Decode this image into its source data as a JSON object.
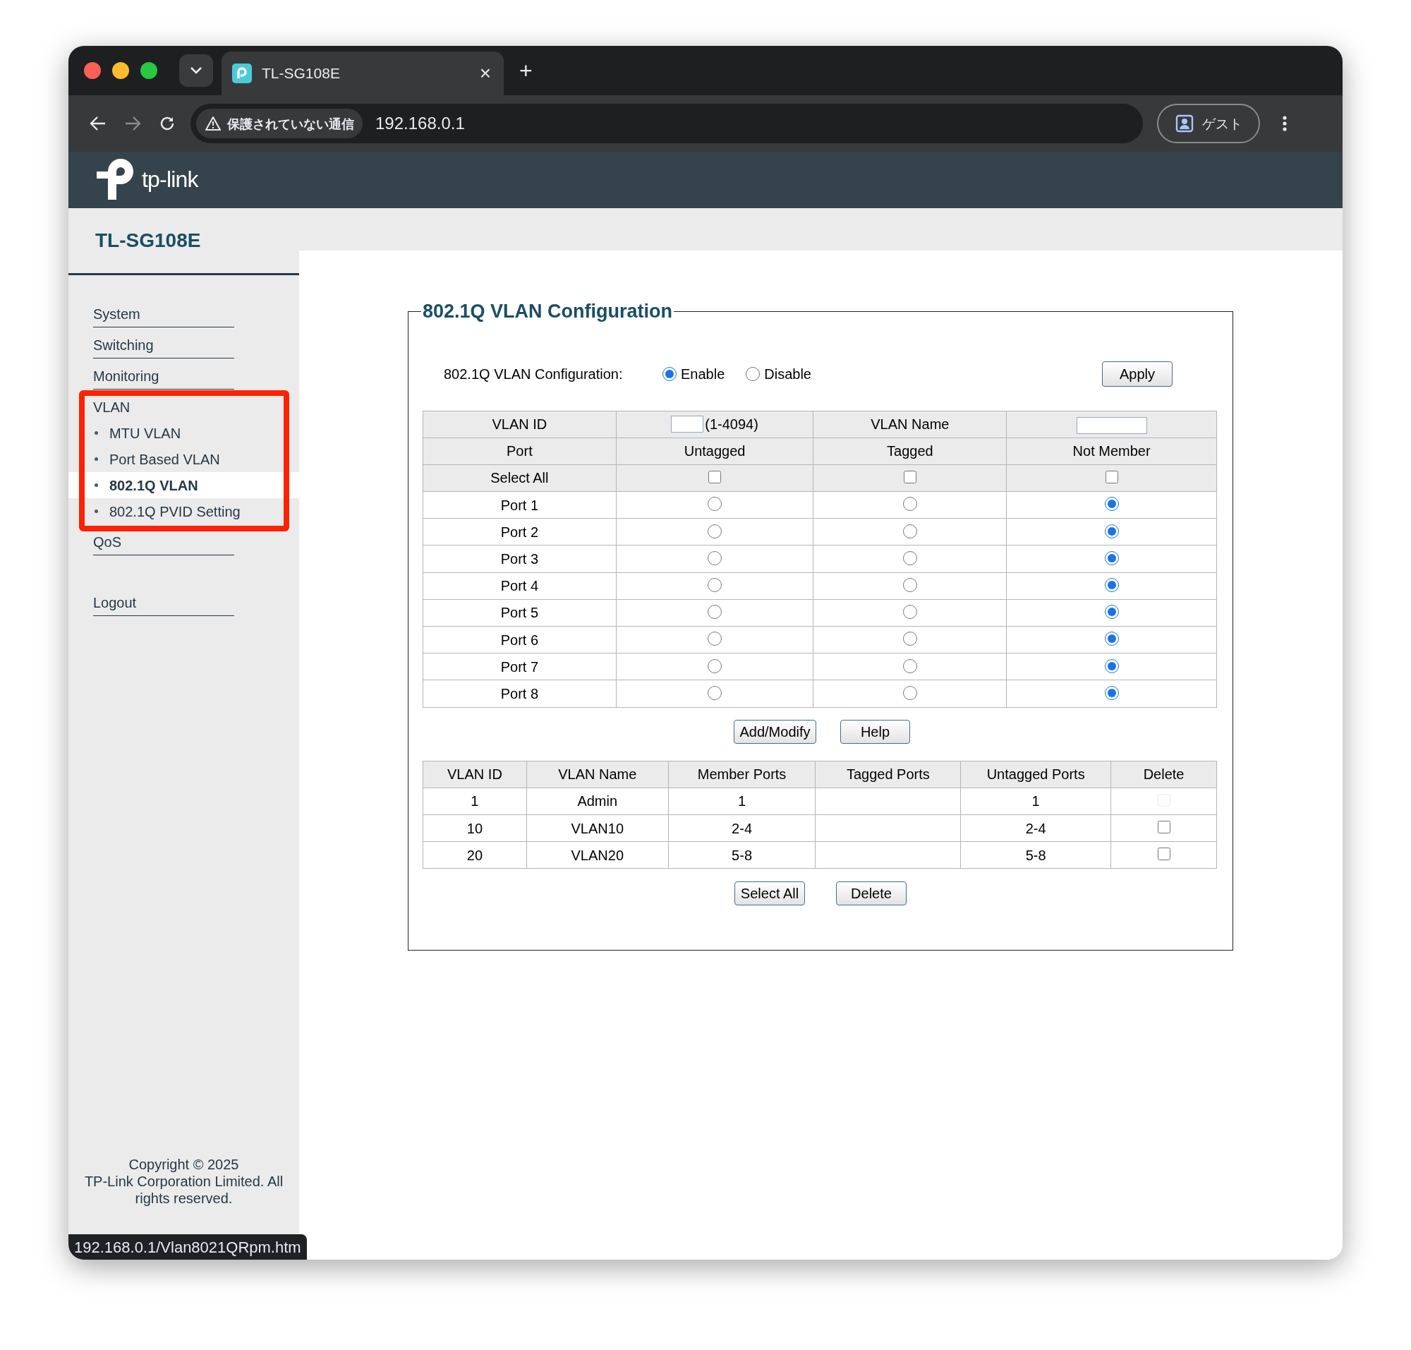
{
  "browser": {
    "tab_title": "TL-SG108E",
    "close_glyph": "×",
    "new_tab_glyph": "+",
    "security_warning": "保護されていない通信",
    "url": "192.168.0.1",
    "profile_label": "ゲスト"
  },
  "brand": {
    "logo_text": "tp-link"
  },
  "sidebar": {
    "title": "TL-SG108E",
    "items": [
      {
        "label": "System",
        "selected": false
      },
      {
        "label": "Switching",
        "selected": false
      },
      {
        "label": "Monitoring",
        "selected": false
      },
      {
        "label": "VLAN",
        "selected": false,
        "expanded": true,
        "children": [
          {
            "label": "MTU VLAN",
            "selected": false
          },
          {
            "label": "Port Based VLAN",
            "selected": false
          },
          {
            "label": "802.1Q VLAN",
            "selected": true
          },
          {
            "label": "802.1Q PVID Setting",
            "selected": false
          }
        ]
      },
      {
        "label": "QoS",
        "selected": false
      },
      {
        "label": "Logout",
        "selected": false
      }
    ],
    "copyright": "Copyright © 2025\nTP-Link Corporation Limited. All rights reserved."
  },
  "config": {
    "legend": "802.1Q VLAN Configuration",
    "label": "802.1Q VLAN Configuration:",
    "options": [
      {
        "label": "Enable",
        "selected": true
      },
      {
        "label": "Disable",
        "selected": false
      }
    ],
    "apply_button": "Apply"
  },
  "vlan_form": {
    "vlan_id_label": "VLAN ID",
    "range_hint": "(1-4094)",
    "vlan_name_label": "VLAN Name",
    "port_header": "Port",
    "columns": [
      "Untagged",
      "Tagged",
      "Not Member"
    ],
    "select_all_label": "Select All",
    "select_all": [
      {
        "checked": false
      },
      {
        "checked": false
      },
      {
        "checked": false
      }
    ],
    "ports": [
      {
        "label": "Port 1",
        "options": [
          {
            "selected": false
          },
          {
            "selected": false
          },
          {
            "selected": true
          }
        ]
      },
      {
        "label": "Port 2",
        "options": [
          {
            "selected": false
          },
          {
            "selected": false
          },
          {
            "selected": true
          }
        ]
      },
      {
        "label": "Port 3",
        "options": [
          {
            "selected": false
          },
          {
            "selected": false
          },
          {
            "selected": true
          }
        ]
      },
      {
        "label": "Port 4",
        "options": [
          {
            "selected": false
          },
          {
            "selected": false
          },
          {
            "selected": true
          }
        ]
      },
      {
        "label": "Port 5",
        "options": [
          {
            "selected": false
          },
          {
            "selected": false
          },
          {
            "selected": true
          }
        ]
      },
      {
        "label": "Port 6",
        "options": [
          {
            "selected": false
          },
          {
            "selected": false
          },
          {
            "selected": true
          }
        ]
      },
      {
        "label": "Port 7",
        "options": [
          {
            "selected": false
          },
          {
            "selected": false
          },
          {
            "selected": true
          }
        ]
      },
      {
        "label": "Port 8",
        "options": [
          {
            "selected": false
          },
          {
            "selected": false
          },
          {
            "selected": true
          }
        ]
      }
    ],
    "buttons": [
      "Add/Modify",
      "Help"
    ]
  },
  "vlan_table": {
    "columns": [
      "VLAN ID",
      "VLAN Name",
      "Member Ports",
      "Tagged Ports",
      "Untagged Ports",
      "Delete"
    ],
    "rows": [
      {
        "vlan_id": "1",
        "name": "Admin",
        "member_ports": "1",
        "untagged_ports": "1",
        "delete": {
          "checked": false,
          "disabled": true
        }
      },
      {
        "vlan_id": "10",
        "name": "VLAN10",
        "member_ports": "2-4",
        "untagged_ports": "2-4",
        "delete": {
          "checked": false,
          "disabled": false
        }
      },
      {
        "vlan_id": "20",
        "name": "VLAN20",
        "member_ports": "5-8",
        "untagged_ports": "5-8",
        "delete": {
          "checked": false,
          "disabled": false
        }
      }
    ],
    "buttons": [
      "Select All",
      "Delete"
    ]
  },
  "status_url": "192.168.0.1/Vlan8021QRpm.htm"
}
